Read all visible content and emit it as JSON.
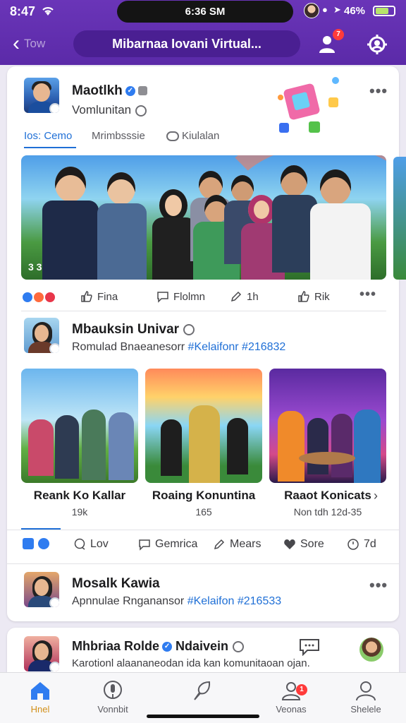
{
  "status": {
    "time": "8:47",
    "island_text": "6:36 SM",
    "battery_pct": "46%"
  },
  "header": {
    "back_label": "Tow",
    "title": "Mibarnaa Iovani Virtual...",
    "notif_badge": "7"
  },
  "post1": {
    "author": "Maotlkh",
    "subtitle": "Vomlunitan",
    "tabs": [
      "Ios: Cemo",
      "Mrimbsssie",
      "Kiulalan"
    ],
    "image_count": "3 3",
    "actions": {
      "like": "Fina",
      "comment": "Flolmn",
      "share": "1h",
      "save": "Rik"
    }
  },
  "post2": {
    "author": "Mbauksin Univar",
    "subtitle_prefix": "Romulad Bnaeanesorr",
    "hashtag": "#Kelaifonr #216832",
    "thumbnails": [
      {
        "title": "Reank Ko Kallar",
        "meta": "19k"
      },
      {
        "title": "Roaing Konuntina",
        "meta": "165"
      },
      {
        "title": "Raaot Konicats",
        "meta": "Non tdh 12d-35"
      }
    ]
  },
  "actionbar": {
    "like": "Lov",
    "comment": "Gemrica",
    "share": "Mears",
    "love": "Sore",
    "more": "7d"
  },
  "post3": {
    "author": "Mosalk Kawia",
    "subtitle_prefix": "Apnnulae Rnganansor",
    "hashtag": "#Kelaifon #216533"
  },
  "post4": {
    "author": "Mhbriaa Rolde",
    "author_suffix": "Ndaivein",
    "subtitle": "Karotionl alaananeodan ida kan komunitaoan ojan."
  },
  "tabbar": {
    "items": [
      {
        "label": "Hnel",
        "icon": "home-icon"
      },
      {
        "label": "Vonnbit",
        "icon": "mic-icon"
      },
      {
        "label": "",
        "icon": "leaf-icon"
      },
      {
        "label": "Veonas",
        "icon": "people-icon",
        "badge": "1"
      },
      {
        "label": "Shelele",
        "icon": "profile-icon"
      }
    ]
  },
  "colors": {
    "accent": "#1f6fd6",
    "brand_purple": "#5b2aa8",
    "active_tab": "#d2901a",
    "badge": "#ff3b3b"
  }
}
